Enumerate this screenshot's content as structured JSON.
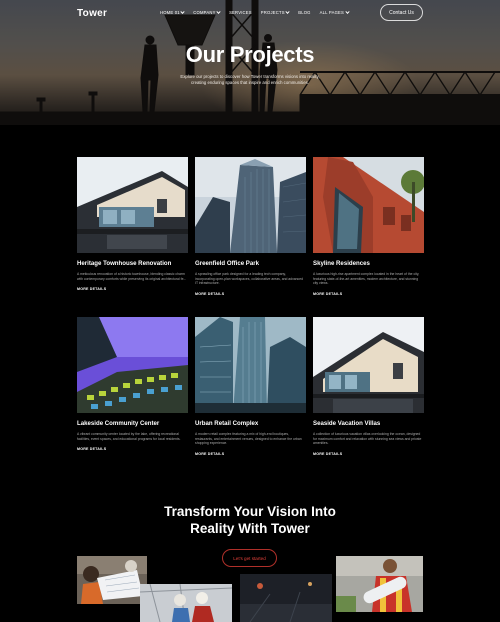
{
  "nav": {
    "logo": "Tower",
    "menu": [
      {
        "label": "HOME 01",
        "has_dropdown": true
      },
      {
        "label": "COMPANY",
        "has_dropdown": true
      },
      {
        "label": "SERVICES",
        "has_dropdown": false
      },
      {
        "label": "PROJECTS",
        "has_dropdown": true
      },
      {
        "label": "BLOG",
        "has_dropdown": false
      },
      {
        "label": "ALL PAGES",
        "has_dropdown": true
      }
    ],
    "contact_label": "Contact Us"
  },
  "hero": {
    "title": "Our Projects",
    "subtitle": "Explore our projects to discover how Tower transforms visions into reality, creating enduring spaces that inspire and enrich communities."
  },
  "projects": [
    {
      "title": "Heritage Townhouse Renovation",
      "description": "A meticulous renovation of a historic townhouse, blending classic charm with contemporary comforts while preserving its original architectural fe...",
      "more": "MORE DETAILS"
    },
    {
      "title": "Greenfield Office Park",
      "description": "A sprawling office park designed for a leading tech company, incorporating open-plan workspaces, collaborative areas, and advanced IT infrastructure.",
      "more": "MORE DETAILS"
    },
    {
      "title": "Skyline Residences",
      "description": "A luxurious high-rise apartment complex located in the heart of the city, featuring state-of-the-art amenities, modern architecture, and stunning city views.",
      "more": "MORE DETAILS"
    },
    {
      "title": "Lakeside Community Center",
      "description": "A vibrant community center located by the lake, offering recreational facilities, event spaces, and educational programs for local residents.",
      "more": "MORE DETAILS"
    },
    {
      "title": "Urban Retail Complex",
      "description": "A modern retail complex featuring a mix of high-end boutiques, restaurants, and entertainment venues, designed to enhance the urban shopping experience.",
      "more": "MORE DETAILS"
    },
    {
      "title": "Seaside Vacation Villas",
      "description": "A collection of luxurious vacation villas overlooking the ocean, designed for maximum comfort and relaxation with stunning sea views and private amenities.",
      "more": "MORE DETAILS"
    }
  ],
  "cta": {
    "title_line1": "Transform Your Vision Into",
    "title_line2": "Reality With Tower",
    "button_label": "Let's get started"
  },
  "colors": {
    "background": "#000000",
    "accent": "#e3413a",
    "text": "#ffffff",
    "muted": "#a9a9a9"
  }
}
